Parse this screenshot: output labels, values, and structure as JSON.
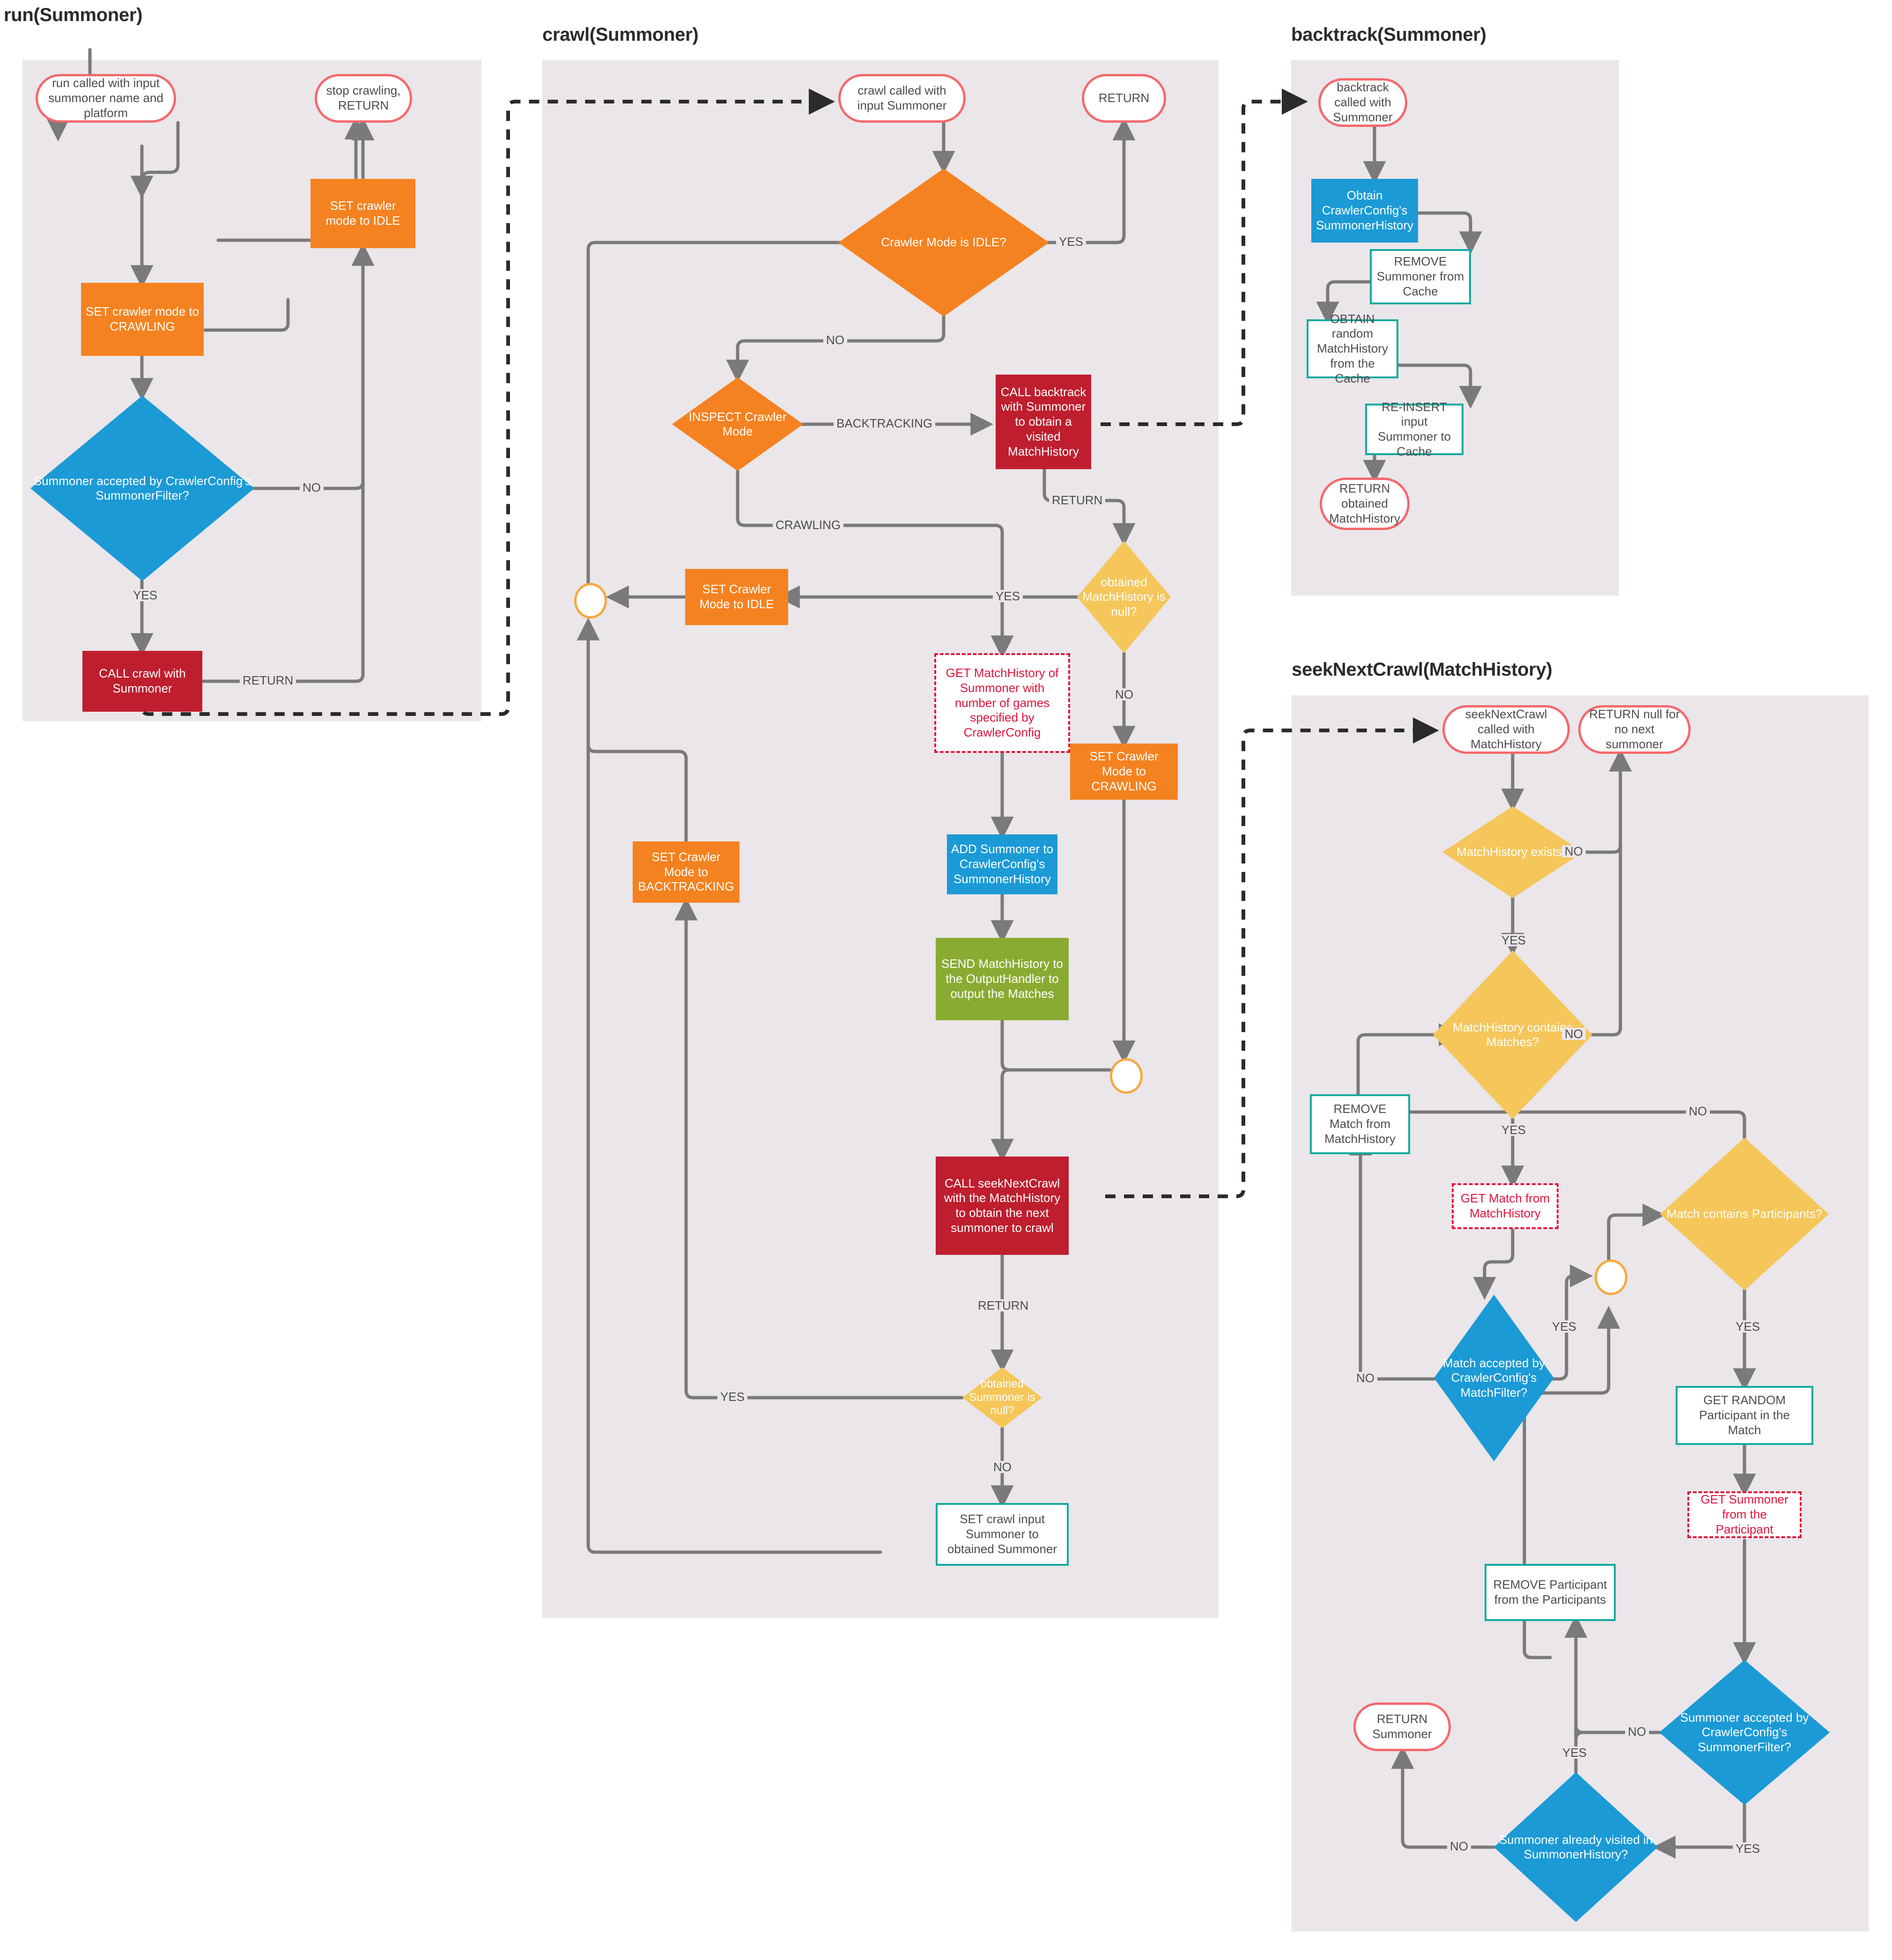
{
  "colors": {
    "panel_bg": "#eae6e9",
    "terminator_border": "#f4696e",
    "orange": "#f58220",
    "blue": "#1b9ad6",
    "red": "#bf1e2e",
    "green": "#8aab32",
    "teal": "#11a9a0",
    "yellow": "#f5c65a",
    "dashed_red": "#e0143c",
    "edge_gray": "#7a7a7a",
    "merge_border": "#f5a93f"
  },
  "panels": [
    {
      "id": "run",
      "title": "run(Summoner)"
    },
    {
      "id": "crawl",
      "title": "crawl(Summoner)"
    },
    {
      "id": "backtrack",
      "title": "backtrack(Summoner)"
    },
    {
      "id": "seeknextcrawl",
      "title": "seekNextCrawl(MatchHistory)"
    }
  ],
  "run": {
    "n_start": "run called with input summoner name and platform",
    "n_stop": "stop crawling, RETURN",
    "n_set_idle": "SET crawler mode to IDLE",
    "n_set_crawl": "SET crawler mode to CRAWLING",
    "n_filter": "Summoner accepted by CrawlerConfig's SummonerFilter?",
    "n_call_crawl": "CALL crawl with Summoner",
    "lbl_no": "NO",
    "lbl_yes": "YES",
    "lbl_return": "RETURN"
  },
  "crawl": {
    "n_start": "crawl called with input Summoner",
    "n_return": "RETURN",
    "n_is_idle": "Crawler Mode is IDLE?",
    "n_inspect": "INSPECT Crawler Mode",
    "n_call_bt": "CALL backtrack with Summoner to obtain a visited MatchHistory",
    "n_mh_null": "obtained MatchHistory is null?",
    "n_set_idle": "SET Crawler Mode to IDLE",
    "n_set_crawling": "SET Crawler Mode to CRAWLING",
    "n_get_mh": "GET MatchHistory of Summoner with number of games specified by CrawlerConfig",
    "n_set_bt": "SET Crawler Mode to BACKTRACKING",
    "n_add_summ": "ADD Summoner to CrawlerConfig's SummonerHistory",
    "n_send_mh": "SEND MatchHistory to the OutputHandler to output the Matches",
    "n_call_snc": "CALL seekNextCrawl with the MatchHistory to obtain the next summoner to crawl",
    "n_summ_null": "obtained Summoner is null?",
    "n_set_input": "SET crawl input Summoner to obtained Summoner",
    "lbl_yes": "YES",
    "lbl_no": "NO",
    "lbl_backtracking": "BACKTRACKING",
    "lbl_crawling": "CRAWLING",
    "lbl_return": "RETURN",
    "lbl_return2": "RETURN",
    "lbl_yes2": "YES",
    "lbl_no2": "NO",
    "lbl_yes3": "YES",
    "lbl_no3": "NO"
  },
  "backtrack": {
    "n_start": "backtrack called with Summoner",
    "n_obtain_sh": "Obtain CrawlerConfig's SummonerHistory",
    "n_remove": "REMOVE Summoner from Cache",
    "n_obtain_mh": "OBTAIN random MatchHistory from the Cache",
    "n_reinsert": "RE-INSERT input Summoner to Cache",
    "n_return": "RETURN obtained MatchHistory"
  },
  "seeknextcrawl": {
    "n_start": "seekNextCrawl called with MatchHistory",
    "n_return_null": "RETURN null for no next summoner",
    "n_mh_exists": "MatchHistory exists?",
    "n_mh_matches": "MatchHistory contains Matches?",
    "n_remove_match": "REMOVE Match from MatchHistory",
    "n_get_match": "GET Match from MatchHistory",
    "n_match_filter": "Match accepted by CrawlerConfig's MatchFilter?",
    "n_match_parts": "Match contains Participants?",
    "n_get_random": "GET RANDOM Participant in the Match",
    "n_get_summ": "GET Summoner from the Participant",
    "n_remove_part": "REMOVE Participant from the Participants",
    "n_summ_filter": "Summoner accepted by CrawlerConfig's SummonerFilter?",
    "n_visited": "Summoner already visited in SummonerHistory?",
    "n_return_summ": "RETURN Summoner",
    "lbl_no1": "NO",
    "lbl_yes1": "YES",
    "lbl_no2": "NO",
    "lbl_yes2": "YES",
    "lbl_no3": "NO",
    "lbl_no4": "NO",
    "lbl_yes3": "YES",
    "lbl_yes4": "YES",
    "lbl_yes5": "YES",
    "lbl_no5": "NO",
    "lbl_yes6": "YES",
    "lbl_no6": "NO"
  }
}
